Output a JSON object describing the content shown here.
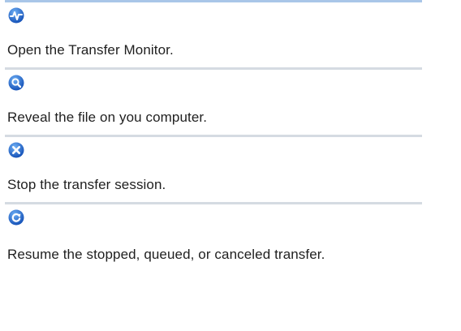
{
  "items": [
    {
      "icon": "transfer-monitor-icon",
      "description": "Open the Transfer Monitor."
    },
    {
      "icon": "magnifier-icon",
      "description": "Reveal the file on you computer."
    },
    {
      "icon": "stop-icon",
      "description": "Stop the transfer session."
    },
    {
      "icon": "resume-icon",
      "description": "Resume the stopped, queued, or canceled transfer."
    }
  ],
  "colors": {
    "icon_blue": "#1a5fc7",
    "icon_blue_light": "#4f95ea",
    "divider": "#d5dbe2",
    "top_rule": "#a9c6e8"
  }
}
